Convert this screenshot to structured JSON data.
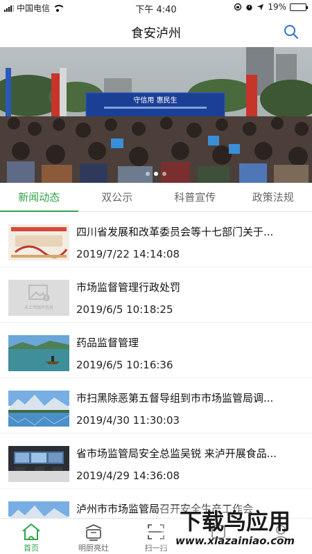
{
  "status_bar": {
    "carrier": "中国电信",
    "time": "下午 4:40",
    "battery": "19%",
    "battery_level": 0.19
  },
  "header": {
    "title": "食安泸州",
    "search_icon": "search-icon"
  },
  "banner": {
    "stage_text": "守信用 惠民生",
    "slides_count": 3,
    "active_slide": 1
  },
  "tabs": [
    {
      "label": "新闻动态",
      "active": true
    },
    {
      "label": "双公示",
      "active": false
    },
    {
      "label": "科普宣传",
      "active": false
    },
    {
      "label": "政策法规",
      "active": false
    }
  ],
  "news": [
    {
      "title": "四川省发展和改革委员会等十七部门关于...",
      "date": "2019/7/22 14:14:08",
      "thumb": "poster"
    },
    {
      "title": "市场监督管理行政处罚",
      "date": "2019/6/5 10:18:25",
      "thumb": "placeholder",
      "thumb_text": "未上传图片信息"
    },
    {
      "title": "药品监督管理",
      "date": "2019/6/5 10:16:36",
      "thumb": "lake-boat"
    },
    {
      "title": "市扫黑除恶第五督导组到市市场监管局调...",
      "date": "2019/4/30 11:30:03",
      "thumb": "mountain-lake"
    },
    {
      "title": "省市场监管局安全总监吴锐 来泸开展食品...",
      "date": "2019/4/29 14:36:08",
      "thumb": "control-room"
    },
    {
      "title": "泸州市市场监管局召开安全生产工作会",
      "date": "",
      "thumb": "mountain-lake"
    }
  ],
  "tabbar": [
    {
      "label": "首页",
      "icon": "home-icon",
      "active": true
    },
    {
      "label": "明厨亮灶",
      "icon": "cooking-pot-icon",
      "active": false
    },
    {
      "label": "扫一扫",
      "icon": "scan-icon",
      "active": false
    },
    {
      "label": "",
      "icon": "tab-icon",
      "active": false
    },
    {
      "label": "",
      "icon": "tab-icon",
      "active": false
    }
  ],
  "watermark": {
    "title": "下载鸟应用",
    "url": "www.xiazainiao.com"
  },
  "colors": {
    "accent": "#2fa34a",
    "text": "#111111",
    "muted": "#666666"
  }
}
